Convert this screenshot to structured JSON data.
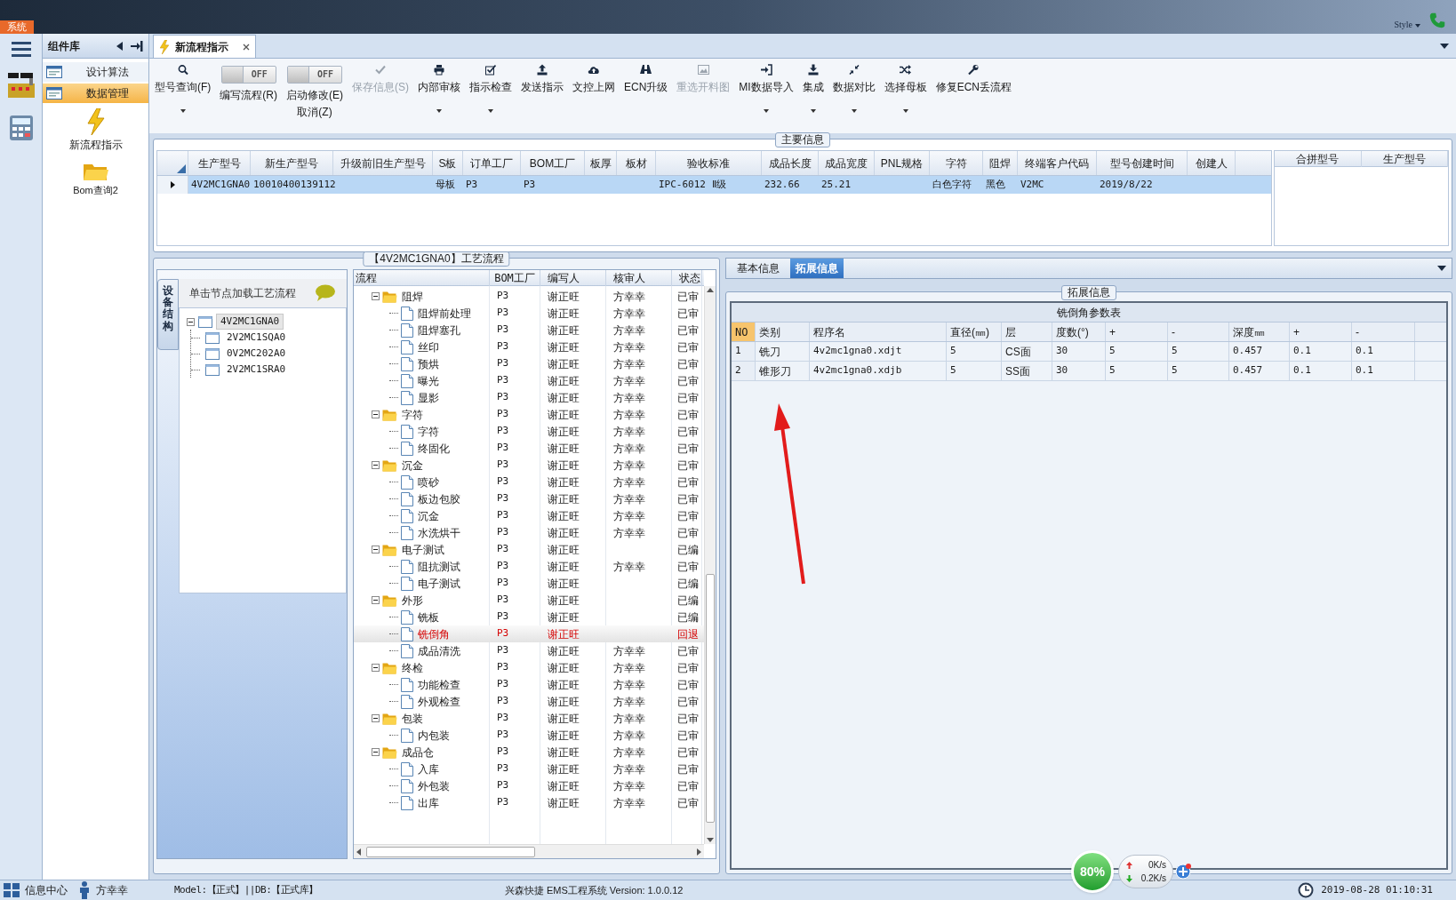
{
  "app": {
    "system_tab": "系统",
    "style_label": "Style"
  },
  "sidebar": {
    "title": "组件库",
    "items": [
      {
        "label": "设计算法",
        "selected": false
      },
      {
        "label": "数据管理",
        "selected": true
      }
    ],
    "launchers": [
      {
        "label": "新流程指示",
        "kind": "lightning"
      },
      {
        "label": "Bom查询2",
        "kind": "folder"
      }
    ]
  },
  "document_tab": {
    "label": "新流程指示",
    "selected": true
  },
  "toolbar": [
    {
      "kind": "button",
      "label": "型号查询(F)",
      "dropdown": true,
      "disabled": false
    },
    {
      "kind": "toggle",
      "switch_text": "OFF",
      "on": false,
      "label": "编写流程(R)"
    },
    {
      "kind": "toggle",
      "switch_text": "OFF",
      "on": false,
      "label": "启动修改(E)",
      "sublabel": "取消(Z)"
    },
    {
      "kind": "button",
      "label": "保存信息(S)",
      "dropdown": false,
      "disabled": true
    },
    {
      "kind": "button",
      "label": "内部审核",
      "dropdown": true,
      "disabled": false
    },
    {
      "kind": "button",
      "label": "指示检查",
      "dropdown": true,
      "disabled": false
    },
    {
      "kind": "button",
      "label": "发送指示",
      "dropdown": false,
      "disabled": false
    },
    {
      "kind": "button",
      "label": "文控上网",
      "dropdown": false,
      "disabled": false
    },
    {
      "kind": "button",
      "label": "ECN升级",
      "dropdown": false,
      "disabled": false
    },
    {
      "kind": "button",
      "label": "重选开料图",
      "dropdown": false,
      "disabled": true
    },
    {
      "kind": "button",
      "label": "MI数据导入",
      "dropdown": true,
      "disabled": false
    },
    {
      "kind": "button",
      "label": "集成",
      "dropdown": true,
      "disabled": false
    },
    {
      "kind": "button",
      "label": "数据对比",
      "dropdown": true,
      "disabled": false
    },
    {
      "kind": "button",
      "label": "选择母板",
      "dropdown": true,
      "disabled": false
    },
    {
      "kind": "button",
      "label": "修复ECN丢流程",
      "dropdown": false,
      "disabled": false
    }
  ],
  "main_info": {
    "title": "主要信息",
    "columns": [
      "生产型号",
      "新生产型号",
      "升级前旧生产型号",
      "S板",
      "订单工厂",
      "BOM工厂",
      "板厚",
      "板材",
      "验收标准",
      "成品长度",
      "成品宽度",
      "PNL规格",
      "字符",
      "阻焊",
      "终端客户代码",
      "型号创建时间",
      "创建人"
    ],
    "rows": [
      {
        "selected": true,
        "cells": [
          "4V2MC1GNA0",
          "10010400139112",
          null,
          "母板",
          "P3",
          "P3",
          null,
          null,
          "IPC-6012 Ⅱ级",
          "232.66",
          "25.21",
          null,
          "白色字符",
          "黑色",
          "V2MC",
          "2019/8/22",
          null
        ]
      }
    ],
    "merge_columns": [
      "合拼型号",
      "生产型号"
    ]
  },
  "process": {
    "title": "【4V2MC1GNA0】工艺流程",
    "side_tab": "设备结构",
    "hint": "单击节点加载工艺流程",
    "product_tree": {
      "label": "4V2MC1GNA0",
      "selected": true,
      "expanded": true,
      "children": [
        {
          "label": "2V2MC1SQA0",
          "selected": false
        },
        {
          "label": "0V2MC202A0",
          "selected": false
        },
        {
          "label": "2V2MC1SRA0",
          "selected": false
        }
      ]
    },
    "columns": [
      "流程",
      "BOM工厂",
      "编写人",
      "核审人",
      "状态"
    ],
    "flow": [
      {
        "name": "阻焊",
        "bom": "P3",
        "writer": "谢正旺",
        "reviewer": "方幸幸",
        "status": "已审",
        "selected": false,
        "expanded": true,
        "children": [
          {
            "name": "阻焊前处理",
            "bom": "P3",
            "writer": "谢正旺",
            "reviewer": "方幸幸",
            "status": "已审",
            "selected": false
          },
          {
            "name": "阻焊塞孔",
            "bom": "P3",
            "writer": "谢正旺",
            "reviewer": "方幸幸",
            "status": "已审",
            "selected": false
          },
          {
            "name": "丝印",
            "bom": "P3",
            "writer": "谢正旺",
            "reviewer": "方幸幸",
            "status": "已审",
            "selected": false
          },
          {
            "name": "预烘",
            "bom": "P3",
            "writer": "谢正旺",
            "reviewer": "方幸幸",
            "status": "已审",
            "selected": false
          },
          {
            "name": "曝光",
            "bom": "P3",
            "writer": "谢正旺",
            "reviewer": "方幸幸",
            "status": "已审",
            "selected": false
          },
          {
            "name": "显影",
            "bom": "P3",
            "writer": "谢正旺",
            "reviewer": "方幸幸",
            "status": "已审",
            "selected": false
          }
        ]
      },
      {
        "name": "字符",
        "bom": "P3",
        "writer": "谢正旺",
        "reviewer": "方幸幸",
        "status": "已审",
        "selected": false,
        "expanded": true,
        "children": [
          {
            "name": "字符",
            "bom": "P3",
            "writer": "谢正旺",
            "reviewer": "方幸幸",
            "status": "已审",
            "selected": false
          },
          {
            "name": "终固化",
            "bom": "P3",
            "writer": "谢正旺",
            "reviewer": "方幸幸",
            "status": "已审",
            "selected": false
          }
        ]
      },
      {
        "name": "沉金",
        "bom": "P3",
        "writer": "谢正旺",
        "reviewer": "方幸幸",
        "status": "已审",
        "selected": false,
        "expanded": true,
        "children": [
          {
            "name": "喷砂",
            "bom": "P3",
            "writer": "谢正旺",
            "reviewer": "方幸幸",
            "status": "已审",
            "selected": false
          },
          {
            "name": "板边包胶",
            "bom": "P3",
            "writer": "谢正旺",
            "reviewer": "方幸幸",
            "status": "已审",
            "selected": false
          },
          {
            "name": "沉金",
            "bom": "P3",
            "writer": "谢正旺",
            "reviewer": "方幸幸",
            "status": "已审",
            "selected": false
          },
          {
            "name": "水洗烘干",
            "bom": "P3",
            "writer": "谢正旺",
            "reviewer": "方幸幸",
            "status": "已审",
            "selected": false
          }
        ]
      },
      {
        "name": "电子测试",
        "bom": "P3",
        "writer": "谢正旺",
        "status": "已编",
        "selected": false,
        "expanded": true,
        "children": [
          {
            "name": "阻抗测试",
            "bom": "P3",
            "writer": "谢正旺",
            "reviewer": "方幸幸",
            "status": "已审",
            "selected": false
          },
          {
            "name": "电子测试",
            "bom": "P3",
            "writer": "谢正旺",
            "status": "已编",
            "selected": false
          }
        ]
      },
      {
        "name": "外形",
        "bom": "P3",
        "writer": "谢正旺",
        "status": "已编",
        "selected": false,
        "expanded": true,
        "children": [
          {
            "name": "铣板",
            "bom": "P3",
            "writer": "谢正旺",
            "status": "已编",
            "selected": false
          },
          {
            "name": "铣倒角",
            "bom": "P3",
            "writer": "谢正旺",
            "status": "回退",
            "selected": true
          },
          {
            "name": "成品清洗",
            "bom": "P3",
            "writer": "谢正旺",
            "reviewer": "方幸幸",
            "status": "已审",
            "selected": false
          }
        ]
      },
      {
        "name": "终检",
        "bom": "P3",
        "writer": "谢正旺",
        "reviewer": "方幸幸",
        "status": "已审",
        "selected": false,
        "expanded": true,
        "children": [
          {
            "name": "功能检查",
            "bom": "P3",
            "writer": "谢正旺",
            "reviewer": "方幸幸",
            "status": "已审",
            "selected": false
          },
          {
            "name": "外观检查",
            "bom": "P3",
            "writer": "谢正旺",
            "reviewer": "方幸幸",
            "status": "已审",
            "selected": false
          }
        ]
      },
      {
        "name": "包装",
        "bom": "P3",
        "writer": "谢正旺",
        "reviewer": "方幸幸",
        "status": "已审",
        "selected": false,
        "expanded": true,
        "children": [
          {
            "name": "内包装",
            "bom": "P3",
            "writer": "谢正旺",
            "reviewer": "方幸幸",
            "status": "已审",
            "selected": false
          }
        ]
      },
      {
        "name": "成品仓",
        "bom": "P3",
        "writer": "谢正旺",
        "reviewer": "方幸幸",
        "status": "已审",
        "selected": false,
        "expanded": true,
        "children": [
          {
            "name": "入库",
            "bom": "P3",
            "writer": "谢正旺",
            "reviewer": "方幸幸",
            "status": "已审",
            "selected": false
          },
          {
            "name": "外包装",
            "bom": "P3",
            "writer": "谢正旺",
            "reviewer": "方幸幸",
            "status": "已审",
            "selected": false
          },
          {
            "name": "出库",
            "bom": "P3",
            "writer": "谢正旺",
            "reviewer": "方幸幸",
            "status": "已审",
            "selected": false
          }
        ]
      }
    ]
  },
  "detail": {
    "tabs": [
      {
        "label": "基本信息",
        "selected": false
      },
      {
        "label": "拓展信息",
        "selected": true
      }
    ],
    "group_title": "拓展信息",
    "table_title": "铣倒角参数表",
    "columns": [
      "NO",
      "类别",
      "程序名",
      "直径(㎜)",
      "层",
      "度数(°)",
      "+",
      "-",
      "深度㎜",
      "+",
      "-"
    ],
    "rows": [
      [
        "1",
        "铣刀",
        "4v2mc1gna0.xdjt",
        "5",
        "CS面",
        "30",
        "5",
        "5",
        "0.457",
        "0.1",
        "0.1"
      ],
      [
        "2",
        "锥形刀",
        "4v2mc1gna0.xdjb",
        "5",
        "SS面",
        "30",
        "5",
        "5",
        "0.457",
        "0.1",
        "0.1"
      ]
    ]
  },
  "network": {
    "load": "80%",
    "upload": "0K/s",
    "download": "0.2K/s"
  },
  "status_bar": {
    "info_center": "信息中心",
    "user": "方幸幸",
    "environment": "Model:【正式】||DB:【正式库】",
    "version": "兴森快捷 EMS工程系统 Version: 1.0.0.12",
    "datetime": "2019-08-28 01:10:31"
  }
}
